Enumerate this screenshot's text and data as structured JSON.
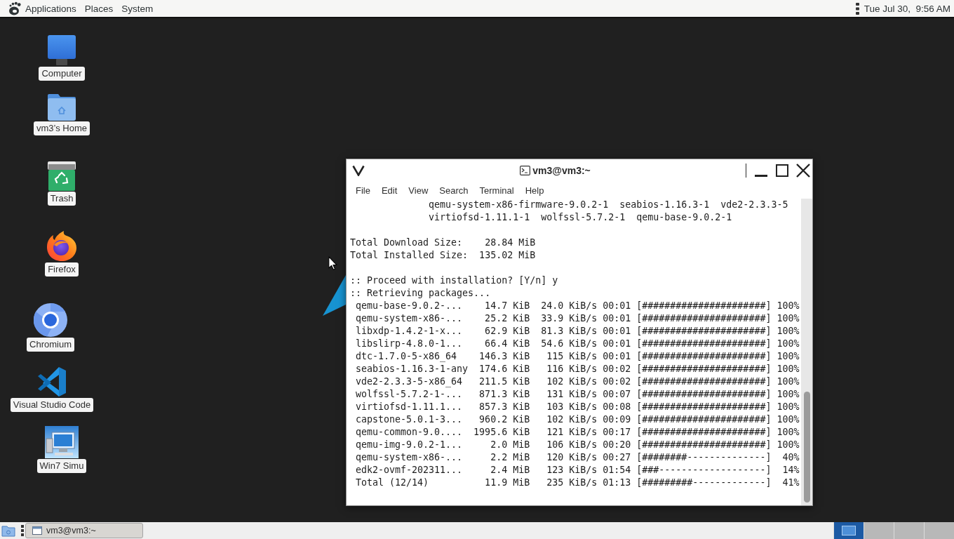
{
  "top_panel": {
    "menus": [
      "Applications",
      "Places",
      "System"
    ],
    "clock": "Tue Jul 30,  9:56 AM"
  },
  "desktop": {
    "icons": [
      {
        "kind": "computer",
        "label": "Computer"
      },
      {
        "kind": "home",
        "label": "vm3’s Home"
      },
      {
        "kind": "trash",
        "label": "Trash"
      },
      {
        "kind": "firefox",
        "label": "Firefox"
      },
      {
        "kind": "chromium",
        "label": "Chromium"
      },
      {
        "kind": "vscode",
        "label": "Visual Studio Code"
      },
      {
        "kind": "shortcut",
        "label": "Win7 Simu"
      }
    ]
  },
  "terminal": {
    "title": "vm3@vm3:~",
    "menu": [
      "File",
      "Edit",
      "View",
      "Search",
      "Terminal",
      "Help"
    ],
    "output": [
      {
        "lines": [
          "              qemu-system-x86-firmware-9.0.2-1  seabios-1.16.3-1  vde2-2.3.3-5",
          "              virtiofsd-1.11.1-1  wolfssl-5.7.2-1  qemu-base-9.0.2-1"
        ]
      },
      {
        "lines": [
          "Total Download Size:    28.84 MiB",
          "Total Installed Size:  135.02 MiB"
        ]
      },
      {
        "lines": [
          ":: Proceed with installation? [Y/n] y",
          ":: Retrieving packages...",
          " qemu-base-9.0.2-...    14.7 KiB  24.0 KiB/s 00:01 [######################] 100%",
          " qemu-system-x86-...    25.2 KiB  33.9 KiB/s 00:01 [######################] 100%",
          " libxdp-1.4.2-1-x...    62.9 KiB  81.3 KiB/s 00:01 [######################] 100%",
          " libslirp-4.8.0-1...    66.4 KiB  54.6 KiB/s 00:01 [######################] 100%",
          " dtc-1.7.0-5-x86_64    146.3 KiB   115 KiB/s 00:01 [######################] 100%",
          " seabios-1.16.3-1-any  174.6 KiB   116 KiB/s 00:02 [######################] 100%",
          " vde2-2.3.3-5-x86_64   211.5 KiB   102 KiB/s 00:02 [######################] 100%",
          " wolfssl-5.7.2-1-...   871.3 KiB   131 KiB/s 00:07 [######################] 100%",
          " virtiofsd-1.11.1...   857.3 KiB   103 KiB/s 00:08 [######################] 100%",
          " capstone-5.0.1-3...   960.2 KiB   102 KiB/s 00:09 [######################] 100%",
          " qemu-common-9.0....  1995.6 KiB   121 KiB/s 00:17 [######################] 100%",
          " qemu-img-9.0.2-1...     2.0 MiB   106 KiB/s 00:20 [######################] 100%",
          " qemu-system-x86-...     2.2 MiB   120 KiB/s 00:27 [########--------------]  40%",
          " edk2-ovmf-202311...     2.4 MiB   123 KiB/s 01:54 [###-------------------]  14%",
          " Total (12/14)          11.9 MiB   235 KiB/s 01:13 [#########-------------]  41%"
        ]
      }
    ]
  },
  "taskbar": {
    "tasks": [
      {
        "label": "vm3@vm3:~",
        "selected": true
      }
    ],
    "workspaces": [
      {
        "selected": true,
        "has_window": true
      },
      {
        "selected": false,
        "has_window": false
      },
      {
        "selected": false,
        "has_window": false
      },
      {
        "selected": false,
        "has_window": false
      }
    ]
  }
}
